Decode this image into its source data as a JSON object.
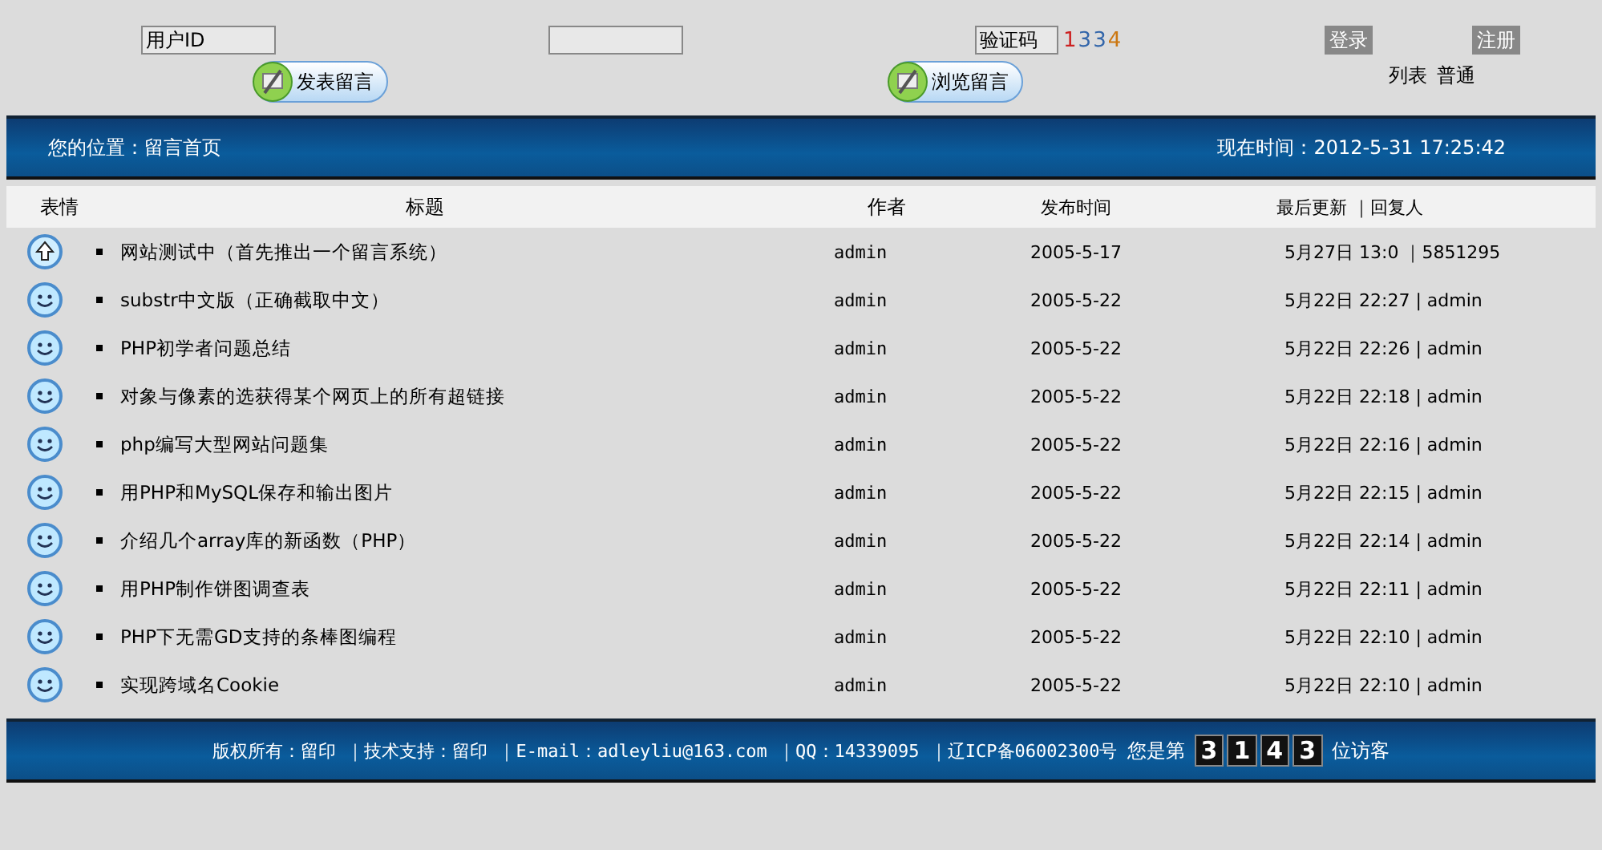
{
  "login": {
    "user_placeholder": "用户ID",
    "captcha_placeholder": "验证码",
    "captcha_digits": [
      {
        "text": "1",
        "color": "#cc2222"
      },
      {
        "text": "3",
        "color": "#3366aa"
      },
      {
        "text": "3",
        "color": "#3366aa"
      },
      {
        "text": "4",
        "color": "#cc7711"
      }
    ],
    "buttons": [
      "登录",
      "注册"
    ]
  },
  "actions": [
    "发表留言",
    "浏览留言"
  ],
  "view_modes": [
    "列表",
    "普通"
  ],
  "location_bar": {
    "location": "您的位置：留言首页",
    "time": "现在时间：2012-5-31 17:25:42"
  },
  "table": {
    "columns": [
      "表情",
      "标题",
      "作者",
      "发布时间",
      "最后更新 ｜回复人"
    ],
    "rows": [
      {
        "kind": "pinned",
        "title": "网站测试中（首先推出一个留言系统）",
        "author": "admin",
        "date": "2005-5-17",
        "last": "5月27日 13:0 ｜5851295"
      },
      {
        "kind": "smile",
        "title": "substr中文版（正确截取中文）",
        "author": "admin",
        "date": "2005-5-22",
        "last": "5月22日 22:27 | admin"
      },
      {
        "kind": "smile",
        "title": "PHP初学者问题总结",
        "author": "admin",
        "date": "2005-5-22",
        "last": "5月22日 22:26 | admin"
      },
      {
        "kind": "smile",
        "title": "对象与像素的选获得某个网页上的所有超链接",
        "author": "admin",
        "date": "2005-5-22",
        "last": "5月22日 22:18 | admin"
      },
      {
        "kind": "smile",
        "title": "php编写大型网站问题集",
        "author": "admin",
        "date": "2005-5-22",
        "last": "5月22日 22:16 | admin"
      },
      {
        "kind": "smile",
        "title": "用PHP和MySQL保存和输出图片",
        "author": "admin",
        "date": "2005-5-22",
        "last": "5月22日 22:15 | admin"
      },
      {
        "kind": "smile",
        "title": "介绍几个array库的新函数（PHP）",
        "author": "admin",
        "date": "2005-5-22",
        "last": "5月22日 22:14 | admin"
      },
      {
        "kind": "smile",
        "title": "用PHP制作饼图调查表",
        "author": "admin",
        "date": "2005-5-22",
        "last": "5月22日 22:11 | admin"
      },
      {
        "kind": "smile",
        "title": "PHP下无需GD支持的条棒图编程",
        "author": "admin",
        "date": "2005-5-22",
        "last": "5月22日 22:10 | admin"
      },
      {
        "kind": "smile",
        "title": "实现跨域名Cookie",
        "author": "admin",
        "date": "2005-5-22",
        "last": "5月22日 22:10 | admin"
      }
    ]
  },
  "footer": {
    "info": "版权所有：留印 ｜技术支持：留印 ｜E-mail：adleyliu@163.com ｜QQ：14339095 ｜辽ICP备06002300号",
    "visitor_prefix": "您是第",
    "counter_digits": [
      "3",
      "1",
      "4",
      "3"
    ],
    "visitor_suffix": "位访客"
  }
}
